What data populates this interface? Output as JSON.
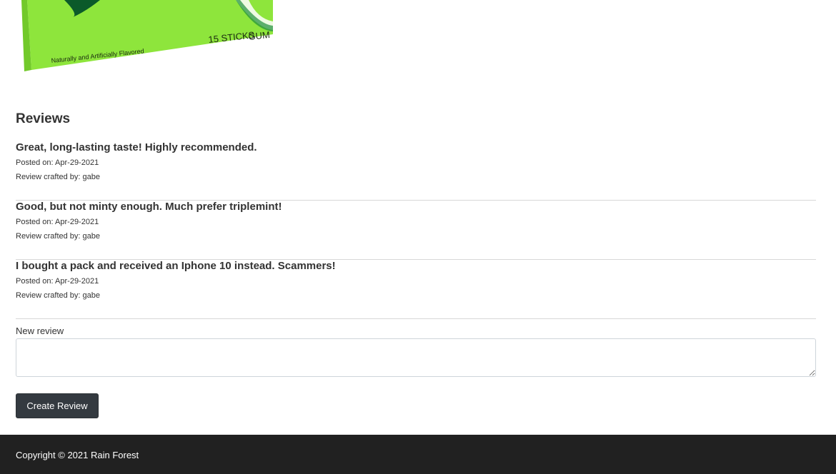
{
  "product": {
    "package_text_sticks": "15 STICKS",
    "package_text_gum": "GUM",
    "package_text_flavor": "Naturally and Artificially Flavored",
    "package_color": "#8ee53c"
  },
  "reviews_section": {
    "heading": "Reviews",
    "items": [
      {
        "title": "Great, long-lasting taste! Highly recommended.",
        "posted": "Posted on: Apr-29-2021",
        "author": "Review crafted by: gabe"
      },
      {
        "title": "Good, but not minty enough. Much prefer triplemint!",
        "posted": "Posted on: Apr-29-2021",
        "author": "Review crafted by: gabe"
      },
      {
        "title": "I bought a pack and received an Iphone 10 instead. Scammers!",
        "posted": "Posted on: Apr-29-2021",
        "author": "Review crafted by: gabe"
      }
    ]
  },
  "new_review_form": {
    "label": "New review",
    "value": "",
    "submit_label": "Create Review"
  },
  "footer": {
    "copyright": "Copyright © 2021 Rain Forest"
  }
}
